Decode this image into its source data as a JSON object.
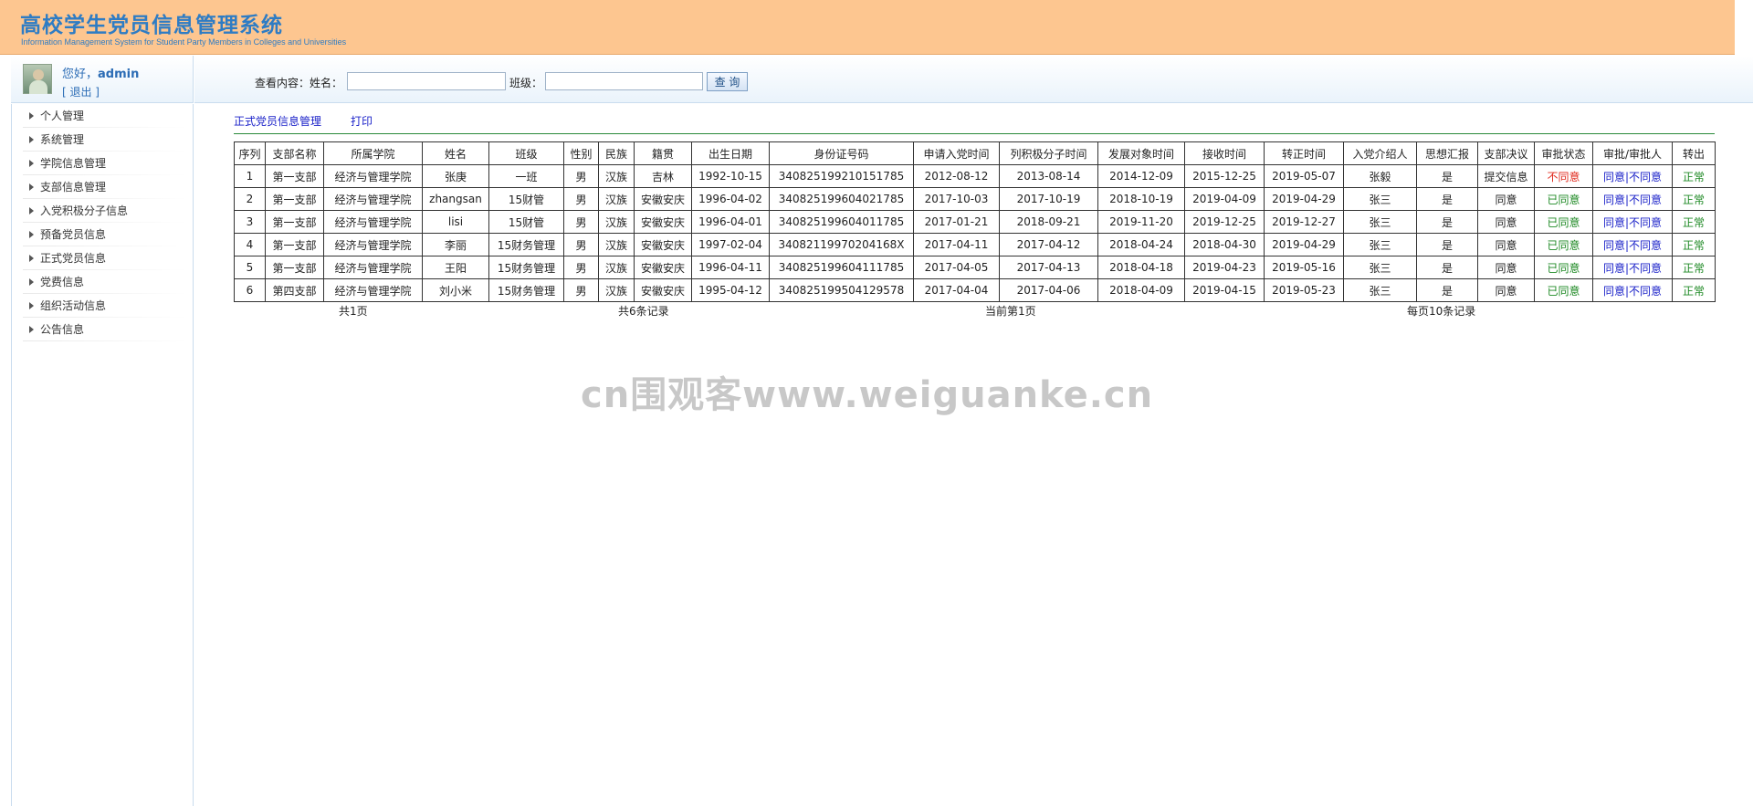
{
  "header": {
    "title": "高校学生党员信息管理系统",
    "subtitle": "Information Management System for Student Party Members in Colleges and Universities"
  },
  "user": {
    "greeting": "您好，",
    "name": "admin",
    "logout": "[ 退出 ]"
  },
  "search": {
    "prefix_label": "查看内容：姓名：",
    "name_value": "",
    "class_label": "班级：",
    "class_value": "",
    "button_label": "查 询"
  },
  "sidebar": {
    "items": [
      {
        "label": "个人管理"
      },
      {
        "label": "系统管理"
      },
      {
        "label": "学院信息管理"
      },
      {
        "label": "支部信息管理"
      },
      {
        "label": "入党积极分子信息"
      },
      {
        "label": "预备党员信息"
      },
      {
        "label": "正式党员信息"
      },
      {
        "label": "党费信息"
      },
      {
        "label": "组织活动信息"
      },
      {
        "label": "公告信息"
      }
    ]
  },
  "tabs": {
    "formal": "正式党员信息管理",
    "print": "打印"
  },
  "table": {
    "headers": [
      "序列",
      "支部名称",
      "所属学院",
      "姓名",
      "班级",
      "性别",
      "民族",
      "籍贯",
      "出生日期",
      "身份证号码",
      "申请入党时间",
      "列积极分子时间",
      "发展对象时间",
      "接收时间",
      "转正时间",
      "入党介绍人",
      "思想汇报",
      "支部决议",
      "审批状态",
      "审批/审批人",
      "转出"
    ],
    "approve_label": "同意",
    "reject_label": "不同意",
    "rows": [
      {
        "seq": "1",
        "branch": "第一支部",
        "college": "经济与管理学院",
        "name": "张庚",
        "class": "一班",
        "gender": "男",
        "ethnic": "汉族",
        "origin": "吉林",
        "birth": "1992-10-15",
        "id": "340825199210151785",
        "apply": "2012-08-12",
        "activist": "2013-08-14",
        "candidate": "2014-12-09",
        "receive": "2015-12-25",
        "regular": "2019-05-07",
        "introducer": "张毅",
        "report": "是",
        "resolution": "提交信息",
        "status": "不同意",
        "status_color": "#e02a1e",
        "transfer": "正常"
      },
      {
        "seq": "2",
        "branch": "第一支部",
        "college": "经济与管理学院",
        "name": "zhangsan",
        "class": "15财管",
        "gender": "男",
        "ethnic": "汉族",
        "origin": "安徽安庆",
        "birth": "1996-04-02",
        "id": "340825199604021785",
        "apply": "2017-10-03",
        "activist": "2017-10-19",
        "candidate": "2018-10-19",
        "receive": "2019-04-09",
        "regular": "2019-04-29",
        "introducer": "张三",
        "report": "是",
        "resolution": "同意",
        "status": "已同意",
        "status_color": "#1f8a25",
        "transfer": "正常"
      },
      {
        "seq": "3",
        "branch": "第一支部",
        "college": "经济与管理学院",
        "name": "lisi",
        "class": "15财管",
        "gender": "男",
        "ethnic": "汉族",
        "origin": "安徽安庆",
        "birth": "1996-04-01",
        "id": "340825199604011785",
        "apply": "2017-01-21",
        "activist": "2018-09-21",
        "candidate": "2019-11-20",
        "receive": "2019-12-25",
        "regular": "2019-12-27",
        "introducer": "张三",
        "report": "是",
        "resolution": "同意",
        "status": "已同意",
        "status_color": "#1f8a25",
        "transfer": "正常"
      },
      {
        "seq": "4",
        "branch": "第一支部",
        "college": "经济与管理学院",
        "name": "李丽",
        "class": "15财务管理",
        "gender": "男",
        "ethnic": "汉族",
        "origin": "安徽安庆",
        "birth": "1997-02-04",
        "id": "34082119970204168X",
        "apply": "2017-04-11",
        "activist": "2017-04-12",
        "candidate": "2018-04-24",
        "receive": "2018-04-30",
        "regular": "2019-04-29",
        "introducer": "张三",
        "report": "是",
        "resolution": "同意",
        "status": "已同意",
        "status_color": "#1f8a25",
        "transfer": "正常"
      },
      {
        "seq": "5",
        "branch": "第一支部",
        "college": "经济与管理学院",
        "name": "王阳",
        "class": "15财务管理",
        "gender": "男",
        "ethnic": "汉族",
        "origin": "安徽安庆",
        "birth": "1996-04-11",
        "id": "340825199604111785",
        "apply": "2017-04-05",
        "activist": "2017-04-13",
        "candidate": "2018-04-18",
        "receive": "2019-04-23",
        "regular": "2019-05-16",
        "introducer": "张三",
        "report": "是",
        "resolution": "同意",
        "status": "已同意",
        "status_color": "#1f8a25",
        "transfer": "正常"
      },
      {
        "seq": "6",
        "branch": "第四支部",
        "college": "经济与管理学院",
        "name": "刘小米",
        "class": "15财务管理",
        "gender": "男",
        "ethnic": "汉族",
        "origin": "安徽安庆",
        "birth": "1995-04-12",
        "id": "340825199504129578",
        "apply": "2017-04-04",
        "activist": "2017-04-06",
        "candidate": "2018-04-09",
        "receive": "2019-04-15",
        "regular": "2019-05-23",
        "introducer": "张三",
        "report": "是",
        "resolution": "同意",
        "status": "已同意",
        "status_color": "#1f8a25",
        "transfer": "正常"
      }
    ]
  },
  "pager": {
    "total_pages": "共1页",
    "total_records": "共6条记录",
    "current_page": "当前第1页",
    "per_page": "每页10条记录"
  },
  "watermark": "cn围观客www.weiguanke.cn",
  "colors": {
    "header_bg": "#fdc690",
    "title_blue": "#2e7cc4",
    "link_blue": "#1b22c9",
    "approved_green": "#1f8a25",
    "rejected_red": "#e02a1e"
  }
}
